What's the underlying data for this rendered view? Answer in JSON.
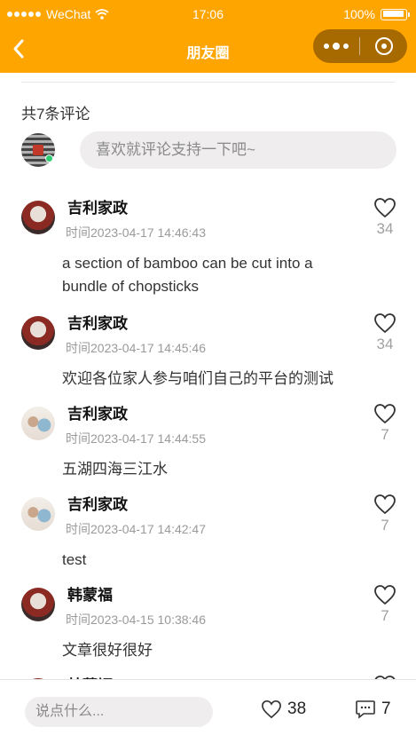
{
  "status_bar": {
    "carrier": "WeChat",
    "time": "17:06",
    "battery": "100%"
  },
  "nav": {
    "title": "朋友圈"
  },
  "comments_header": {
    "count_text": "共7条评论",
    "input_placeholder": "喜欢就评论支持一下吧~"
  },
  "comments": [
    {
      "name": "吉利家政",
      "time": "时间2023-04-17 14:46:43",
      "likes": "34",
      "text": "a section of bamboo can be cut into a bundle of chopsticks",
      "avatar": "red"
    },
    {
      "name": "吉利家政",
      "time": "时间2023-04-17 14:45:46",
      "likes": "34",
      "text": "欢迎各位家人参与咱们自己的平台的测试",
      "avatar": "red"
    },
    {
      "name": "吉利家政",
      "time": "时间2023-04-17 14:44:55",
      "likes": "7",
      "text": "五湖四海三江水",
      "avatar": "people"
    },
    {
      "name": "吉利家政",
      "time": "时间2023-04-17 14:42:47",
      "likes": "7",
      "text": "test",
      "avatar": "people"
    },
    {
      "name": "韩蒙福",
      "time": "时间2023-04-15 10:38:46",
      "likes": "7",
      "text": "文章很好很好",
      "avatar": "red"
    },
    {
      "name": "韩蒙福",
      "time": "",
      "likes": "",
      "text": "",
      "avatar": "red"
    }
  ],
  "bottom_bar": {
    "input_placeholder": "说点什么...",
    "like_count": "38",
    "comment_count": "7"
  },
  "colors": {
    "accent": "#FFA500",
    "capsule": "#A76A00"
  }
}
